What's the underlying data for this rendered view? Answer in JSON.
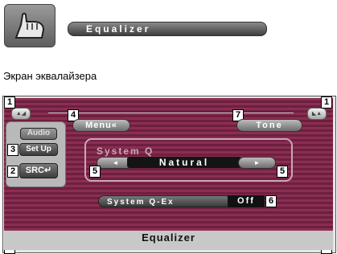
{
  "header": {
    "icon": "hand-touch-icon",
    "title": "Equalizer"
  },
  "caption": "Экран эквалайзера",
  "screen": {
    "menu_label": "Menu«",
    "tone_label": "Tone",
    "left_panel": {
      "audio_label": "Audio",
      "setup_label": "Set Up",
      "src_label": "SRC"
    },
    "system_q": {
      "label": "System Q",
      "left_arrow": "◄",
      "right_arrow": "►",
      "value": "Natural"
    },
    "system_q_ex": {
      "label": "System Q-Ex",
      "value": "Off"
    },
    "bottom_title": "Equalizer"
  },
  "callouts": {
    "c1": "1",
    "c2": "2",
    "c3": "3",
    "c4": "4",
    "c5": "5",
    "c6": "6",
    "c7": "7"
  },
  "colors": {
    "stripe_dark": "#6e1f3f",
    "stripe_light": "#8a2f52",
    "frame": "#c9a7b8"
  }
}
